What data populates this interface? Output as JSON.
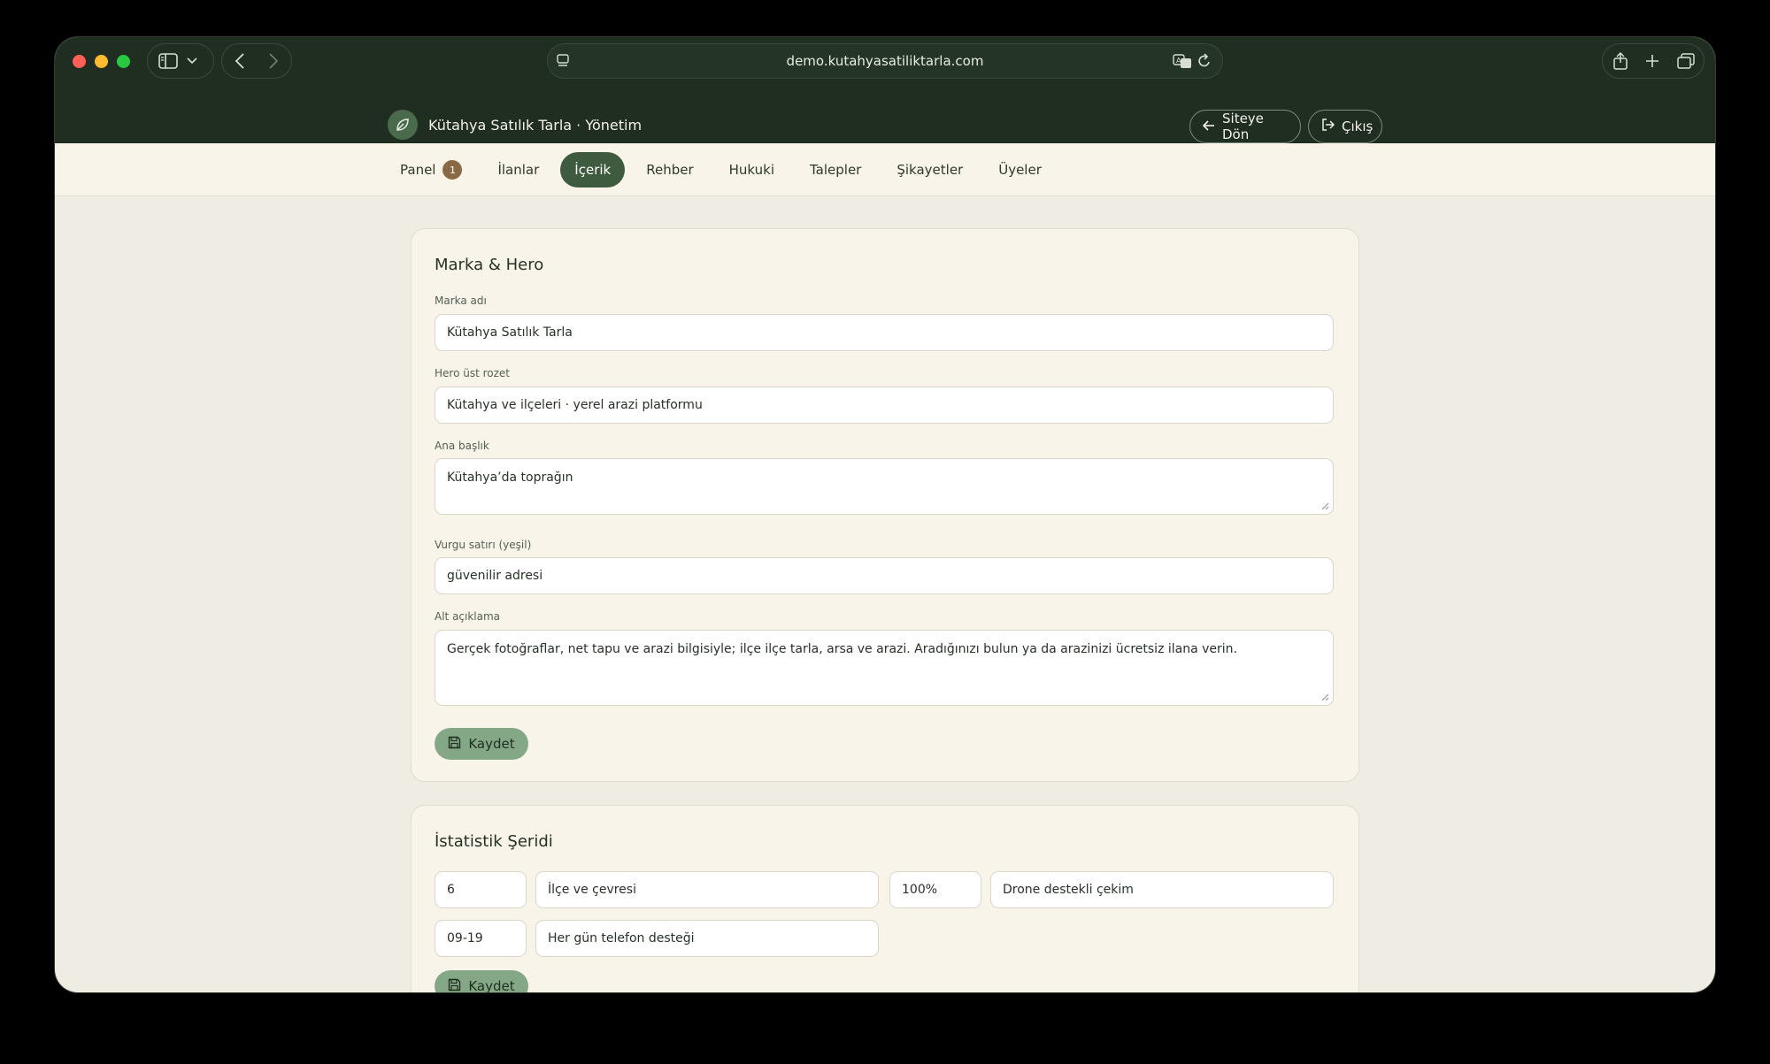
{
  "browser": {
    "url": "demo.kutahyasatiliktarla.com"
  },
  "admin": {
    "brand": "Kütahya Satılık Tarla · Yönetim",
    "back_button": "Siteye Dön",
    "logout_button": "Çıkış"
  },
  "nav": {
    "items": [
      {
        "label": "Panel",
        "badge": "1"
      },
      {
        "label": "İlanlar"
      },
      {
        "label": "İçerik"
      },
      {
        "label": "Rehber"
      },
      {
        "label": "Hukuki"
      },
      {
        "label": "Talepler"
      },
      {
        "label": "Şikayetler"
      },
      {
        "label": "Üyeler"
      }
    ],
    "active": "İçerik"
  },
  "hero_card": {
    "title": "Marka & Hero",
    "brand_label": "Marka adı",
    "brand_value": "Kütahya Satılık Tarla",
    "badge_label": "Hero üst rozet",
    "badge_value": "Kütahya ve ilçeleri · yerel arazi platformu",
    "title_label": "Ana başlık",
    "title_value": "Kütahya’da toprağın",
    "accent_label": "Vurgu satırı (yeşil)",
    "accent_value": "güvenilir adresi",
    "desc_label": "Alt açıklama",
    "desc_value": "Gerçek fotoğraflar, net tapu ve arazi bilgisiyle; ilçe ilçe tarla, arsa ve arazi. Aradığınızı bulun ya da arazinizi ücretsiz ilana verin.",
    "save": "Kaydet"
  },
  "stats_card": {
    "title": "İstatistik Şeridi",
    "stats": [
      {
        "value": "6",
        "label": "İlçe ve çevresi"
      },
      {
        "value": "100%",
        "label": "Drone destekli çekim"
      },
      {
        "value": "09-19",
        "label": "Her gün telefon desteği"
      }
    ],
    "save": "Kaydet"
  },
  "colors": {
    "header_bg": "#1f2e20",
    "nav_active": "#3e5a3f",
    "save_button": "#84a886",
    "badge": "#8a6a45"
  }
}
